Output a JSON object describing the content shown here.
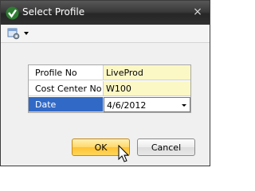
{
  "window": {
    "title": "Select Profile",
    "close_glyph": "×"
  },
  "toolbar": {
    "icon": "layout-settings-icon"
  },
  "properties": [
    {
      "label": "Profile No",
      "value": "LiveProd"
    },
    {
      "label": "Cost Center No",
      "value": "W100"
    },
    {
      "label": "Date",
      "value": "4/6/2012"
    }
  ],
  "buttons": {
    "ok": "OK",
    "cancel": "Cancel"
  },
  "colors": {
    "titlebar": "#2e2e2e",
    "value_cell": "#fcf8c6",
    "selected_row": "#3169c6",
    "ok_button": "#ffd065"
  }
}
